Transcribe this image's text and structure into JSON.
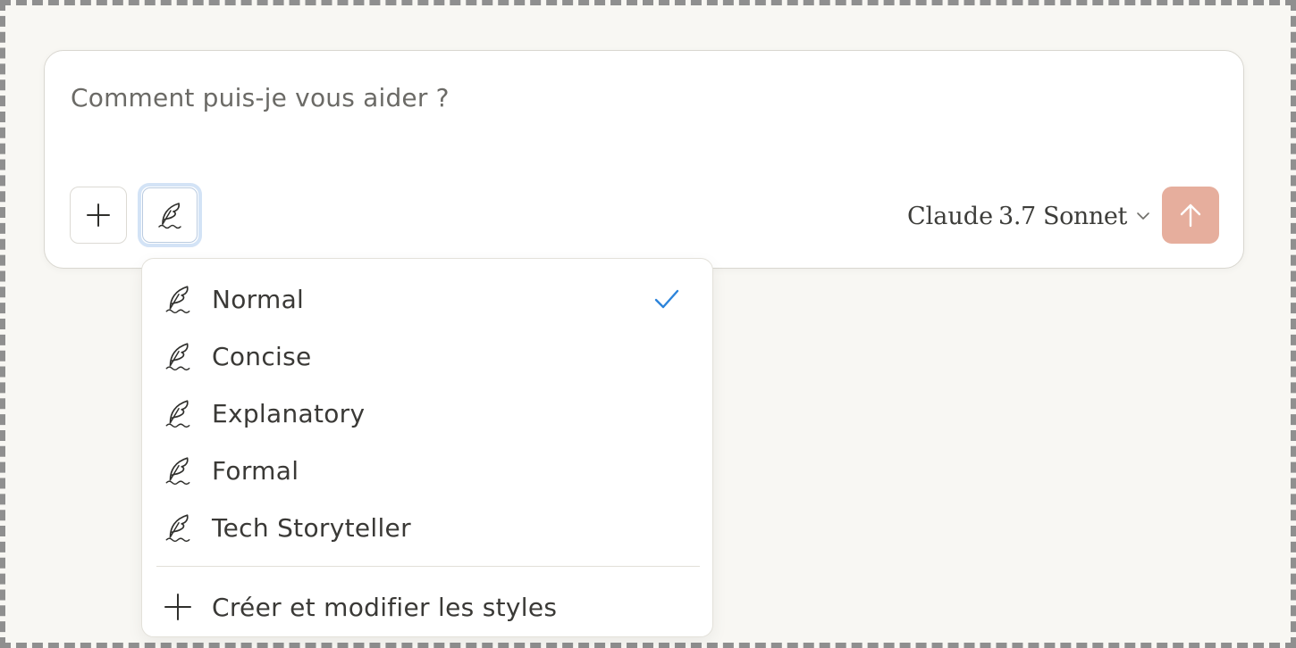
{
  "composer": {
    "placeholder": "Comment puis-je vous aider ?",
    "attach_icon": "plus-icon",
    "style_icon": "quill-icon",
    "model": {
      "brand": "Claude",
      "version": "3.7 Sonnet",
      "icon": "chevron-down-icon"
    },
    "send_icon": "arrow-up-icon",
    "send_color": "#e6ae9d"
  },
  "style_menu": {
    "items": [
      {
        "label": "Normal",
        "icon": "quill-icon",
        "selected": true
      },
      {
        "label": "Concise",
        "icon": "quill-icon",
        "selected": false
      },
      {
        "label": "Explanatory",
        "icon": "quill-icon",
        "selected": false
      },
      {
        "label": "Formal",
        "icon": "quill-icon",
        "selected": false
      },
      {
        "label": "Tech Storyteller",
        "icon": "quill-icon",
        "selected": false
      }
    ],
    "create_label": "Créer et modifier les styles",
    "create_icon": "plus-icon",
    "check_color": "#2c84db"
  }
}
